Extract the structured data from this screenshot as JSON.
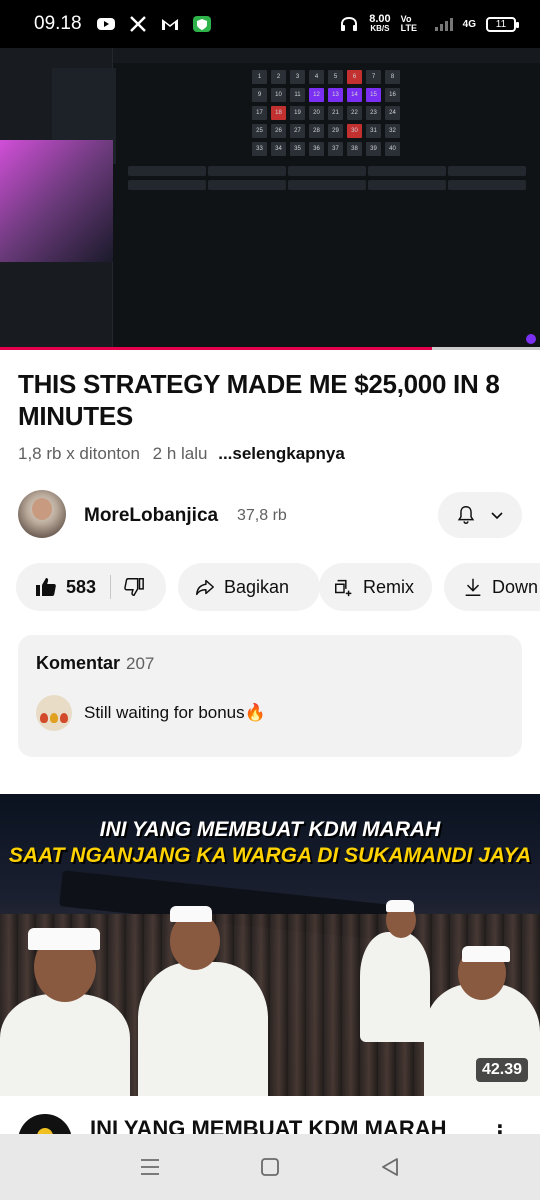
{
  "status_bar": {
    "time": "09.18",
    "network_speed": "8.00",
    "network_unit": "KB/S",
    "volte": "Vo LTE",
    "network_type": "4G",
    "battery": "11",
    "icons": [
      "youtube-icon",
      "x-icon",
      "gmail-icon",
      "shield-app-icon",
      "headphones-icon",
      "signal-icon",
      "battery-icon"
    ]
  },
  "player": {
    "progress_fraction": 0.8,
    "grid_numbers": [
      "1",
      "2",
      "3",
      "4",
      "5",
      "6",
      "7",
      "8",
      "9",
      "10",
      "11",
      "12",
      "13",
      "14",
      "15",
      "16",
      "17",
      "18",
      "19",
      "20",
      "21",
      "22",
      "23",
      "24",
      "25",
      "26",
      "27",
      "28",
      "29",
      "30",
      "31",
      "32",
      "33",
      "34",
      "35",
      "36",
      "37",
      "38",
      "39",
      "40"
    ]
  },
  "video": {
    "title": "THIS STRATEGY MADE ME $25,000 IN 8 MINUTES",
    "views": "1,8 rb x ditonton",
    "age": "2 h lalu",
    "more": "...selengkapnya"
  },
  "channel": {
    "name": "MoreLobanjica",
    "subscribers": "37,8 rb"
  },
  "actions": {
    "likes": "583",
    "share": "Bagikan",
    "remix": "Remix",
    "download": "Down"
  },
  "comments": {
    "label": "Komentar",
    "count": "207",
    "top_comment": "Still waiting for bonus🔥"
  },
  "next_video": {
    "thumb_line1": "INI YANG MEMBUAT KDM MARAH",
    "thumb_line2": "SAAT NGANJANG KA WARGA DI SUKAMANDI JAYA",
    "duration": "42.39",
    "title": "INI YANG MEMBUAT KDM MARAH"
  },
  "colors": {
    "progress_red": "#e5004d",
    "chip_bg": "#f2f2f2",
    "accent_purple": "#7b2ff2",
    "thumb_yellow": "#ffd200"
  }
}
